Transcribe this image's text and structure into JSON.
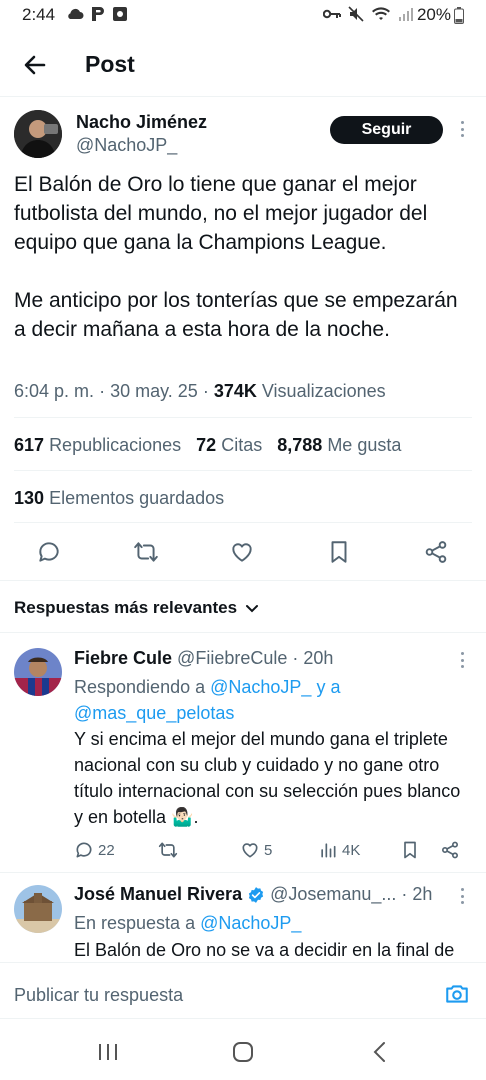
{
  "status_bar": {
    "time": "2:44",
    "battery": "20%"
  },
  "header": {
    "title": "Post"
  },
  "post": {
    "author_name": "Nacho Jiménez",
    "author_handle": "@NachoJP_",
    "follow_label": "Seguir",
    "text_p1": "El Balón de Oro lo tiene que ganar el mejor futbolista del mundo, no el mejor jugador del equipo que gana la Champions League.",
    "text_p2": "Me anticipo por los tonterías que se empezarán a decir mañana a esta hora de la noche.",
    "time": "6:04 p. m.",
    "sep1": "·",
    "date": "30 may. 25",
    "sep2": "·",
    "views": "374K",
    "views_label": "Visualizaciones",
    "reposts": "617",
    "reposts_label": "Republicaciones",
    "quotes": "72",
    "quotes_label": "Citas",
    "likes": "8,788",
    "likes_label": "Me gusta",
    "bookmarks": "130",
    "bookmarks_label": "Elementos guardados"
  },
  "replies_header": "Respuestas más relevantes",
  "replies": [
    {
      "name": "Fiebre Cule",
      "handle": "@FiiebreCule",
      "dot": "·",
      "time": "20h",
      "replying_prefix": "Respondiendo a",
      "replying_to_1": "@NachoJP_",
      "replying_conj": "y a",
      "replying_to_2": "@mas_que_pelotas",
      "text": "Y si encima el mejor del mundo gana el triplete nacional con su club y cuidado y no gane otro título internacional con su selección pues blanco y en botella 🤷🏻‍♂️.",
      "replies": "22",
      "likes": "5",
      "views": "4K"
    },
    {
      "name": "José Manuel Rivera",
      "handle": "@Josemanu_...",
      "dot": "·",
      "time": "2h",
      "replying_prefix": "En respuesta a",
      "replying_to_1": "@NachoJP_",
      "text": "El Balón de Oro no se va a decidir en la final de"
    }
  ],
  "composer": {
    "placeholder": "Publicar tu respuesta"
  },
  "colors": {
    "accent": "#1d9bf0",
    "text": "#0f1419",
    "muted": "#536471",
    "verified": "#1d9bf0"
  },
  "icons": [
    "back-arrow-icon",
    "reply-icon",
    "repost-icon",
    "like-icon",
    "bookmark-icon",
    "share-icon",
    "views-icon",
    "camera-icon",
    "verified-badge-icon",
    "chevron-down-icon"
  ]
}
